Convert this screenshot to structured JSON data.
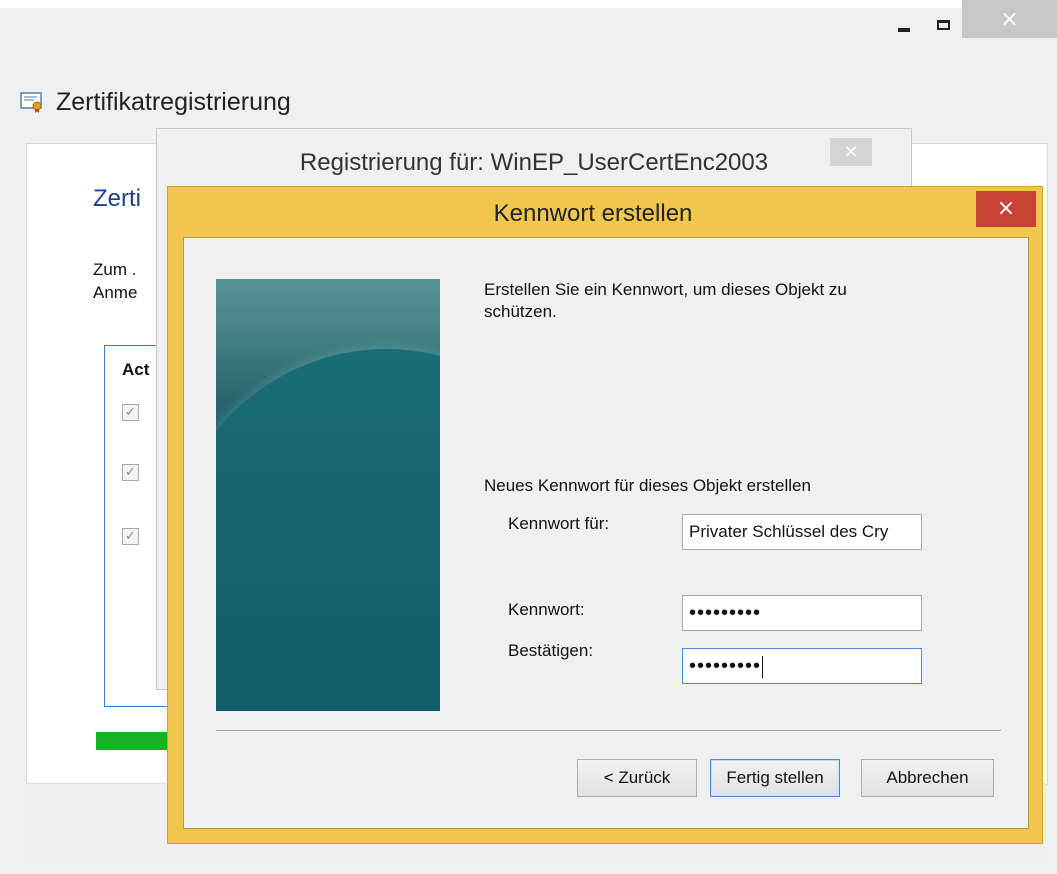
{
  "outer_window": {
    "title": "Zertifikatregistrierung",
    "heading_partial": "Zerti",
    "text_line1_partial": "Zum .",
    "text_line2_partial": "Anme",
    "list_header_partial": "Act",
    "close_glyph": "×",
    "icons": [
      "certificate-icon",
      "minimize-icon",
      "maximize-icon",
      "close-icon"
    ]
  },
  "middle_dialog": {
    "title": "Registrierung für: WinEP_UserCertEnc2003",
    "close_glyph": "×"
  },
  "password_dialog": {
    "title": "Kennwort erstellen",
    "close_glyph": "×",
    "instruction_line1": "Erstellen Sie ein Kennwort, um dieses Objekt zu",
    "instruction_line2": "schützen.",
    "new_password_label": "Neues Kennwort für dieses Objekt erstellen",
    "password_for_label": "Kennwort für:",
    "password_for_value": "Privater Schlüssel des Cry",
    "password_label": "Kennwort:",
    "password_value": "•••••••••",
    "confirm_label": "Bestätigen:",
    "confirm_value": "•••••••••",
    "buttons": {
      "back": "< Zurück",
      "finish": "Fertig stellen",
      "cancel": "Abbrechen"
    },
    "accent_color": "#f0c64c",
    "close_color": "#c74436"
  }
}
